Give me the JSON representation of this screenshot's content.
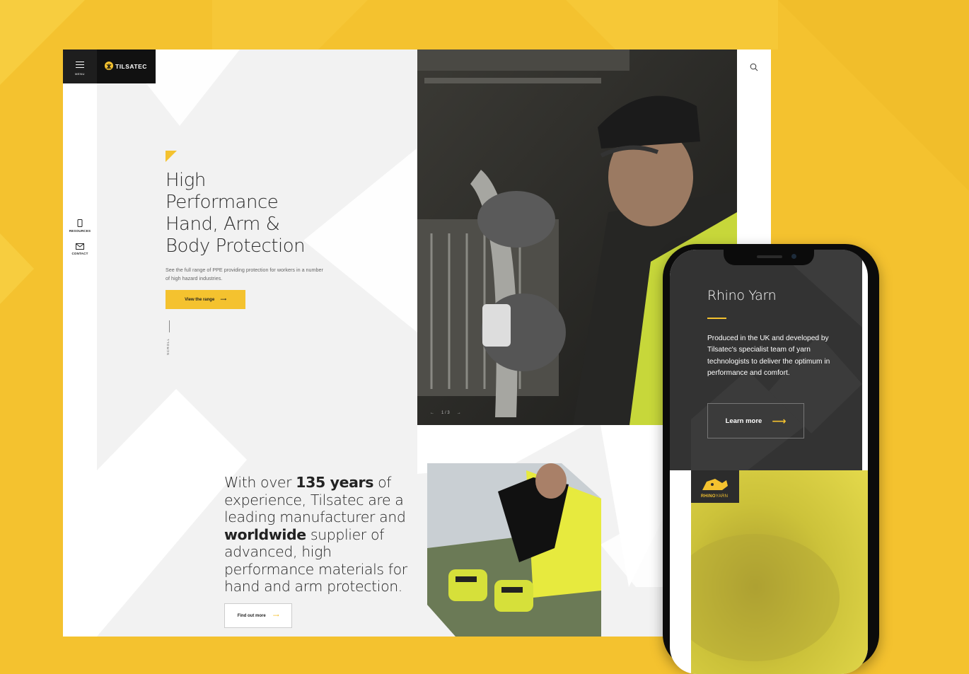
{
  "colors": {
    "accent": "#f4c22f",
    "dark": "#1e1e1e",
    "panel": "#333333"
  },
  "desktop": {
    "menu_label": "MENU",
    "logo_text": "TILSATEC",
    "sidebar": [
      {
        "label": "RESOURCES",
        "icon": "phone-icon"
      },
      {
        "label": "CONTACT",
        "icon": "mail-icon"
      }
    ],
    "hero": {
      "title_lines": [
        "High",
        "Performance",
        "Hand, Arm &",
        "Body Protection"
      ],
      "subtitle": "See the full range of PPE providing protection for workers in a number of high hazard industries.",
      "cta": "View the range",
      "scroll": "SCROLL",
      "slide_counter": "1 / 3"
    },
    "intro": {
      "pre": "With over ",
      "bold1": "135 years",
      "mid": " of experience, Tilsatec are a leading manufacturer and ",
      "bold2": "worldwide",
      "post": " supplier of advanced, high performance materials for hand and arm protection.",
      "cta": "Find out more"
    }
  },
  "mobile": {
    "title": "Rhino Yarn",
    "body": "Produced in the UK and developed by Tilsatec's specialist team of yarn technologists to deliver the optimum in performance and comfort.",
    "cta": "Learn more",
    "badge_rhino": "RHINO",
    "badge_yarn": "YARN"
  }
}
